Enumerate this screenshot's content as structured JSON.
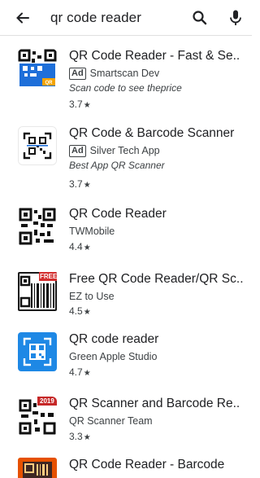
{
  "search": {
    "query": "qr code reader",
    "back_icon": "arrow-back-icon",
    "search_icon": "search-icon",
    "mic_icon": "mic-icon"
  },
  "results": [
    {
      "title": "QR Code Reader - Fast & Se..",
      "is_ad": true,
      "ad_label": "Ad",
      "developer": "Smartscan Dev",
      "tagline": "Scan code to see theprice",
      "rating": "3.7",
      "star": "★"
    },
    {
      "title": "QR Code & Barcode Scanner",
      "is_ad": true,
      "ad_label": "Ad",
      "developer": "Silver Tech App",
      "tagline": "Best App QR Scanner",
      "rating": "3.7",
      "star": "★"
    },
    {
      "title": "QR Code Reader",
      "is_ad": false,
      "developer": "TWMobile",
      "rating": "4.4",
      "star": "★"
    },
    {
      "title": "Free QR Code Reader/QR Sc..",
      "is_ad": false,
      "developer": "EZ to Use",
      "rating": "4.5",
      "star": "★",
      "icon_badge": "FREE"
    },
    {
      "title": "QR code reader",
      "is_ad": false,
      "developer": "Green Apple Studio",
      "rating": "4.7",
      "star": "★"
    },
    {
      "title": "QR Scanner and Barcode Re..",
      "is_ad": false,
      "developer": "QR Scanner Team",
      "rating": "3.3",
      "star": "★",
      "icon_badge": "2019"
    },
    {
      "title": "QR Code Reader - Barcode",
      "is_ad": false
    }
  ],
  "colors": {
    "text_primary": "#202124",
    "text_secondary": "#3c4043",
    "icon_blue": "#1e6fd9",
    "icon_red": "#d32f2f",
    "icon_orange": "#e65100"
  }
}
